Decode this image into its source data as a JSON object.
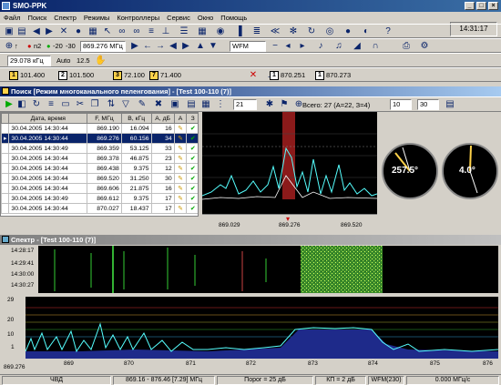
{
  "title": "SMO-PPK",
  "menu": [
    "Файл",
    "Поиск",
    "Спектр",
    "Режимы",
    "Контроллеры",
    "Сервис",
    "Окно",
    "Помощь"
  ],
  "clock": "14:31:17",
  "toolbar2": {
    "n2": "n2",
    "n20": "-20",
    "n30": "-30",
    "freq": "869.276 МГц",
    "mode": "WFM"
  },
  "toolbar3": {
    "step": "29.078 кГц",
    "auto": "Auto",
    "auto_val": "12.5"
  },
  "toolbar4": {
    "b1": "101.400",
    "b2": "101.500",
    "b3": "72.100",
    "b4": "71.400",
    "c1": "870.251",
    "c2": "870.273"
  },
  "search_window": {
    "title": "Поиск [Режим многоканального пеленгования] - [Test 100-110 (7)]",
    "spin1": "21",
    "total": "Всего: 27 (А=22, З=4)",
    "spin2": "10",
    "spin3": "30"
  },
  "table": {
    "headers": [
      "Дата, время",
      "F, МГц",
      "В, кГц",
      "А, дБ",
      "А",
      "З"
    ],
    "rows": [
      [
        "30.04.2005 14:30:44",
        "869.190",
        "16.094",
        "16"
      ],
      [
        "30.04.2005 14:30:44",
        "869.276",
        "60.156",
        "34"
      ],
      [
        "30.04.2005 14:30:49",
        "869.359",
        "53.125",
        "33"
      ],
      [
        "30.04.2005 14:30:44",
        "869.378",
        "46.875",
        "23"
      ],
      [
        "30.04.2005 14:30:44",
        "869.438",
        "9.375",
        "12"
      ],
      [
        "30.04.2005 14:30:44",
        "869.520",
        "31.250",
        "30"
      ],
      [
        "30.04.2005 14:30:44",
        "869.606",
        "21.875",
        "16"
      ],
      [
        "30.04.2005 14:30:49",
        "869.612",
        "9.375",
        "17"
      ],
      [
        "30.04.2005 14:30:44",
        "870.027",
        "18.437",
        "17"
      ]
    ]
  },
  "spectrum_small": {
    "ticks": [
      "869.029",
      "869.276",
      "869.520"
    ]
  },
  "compass": {
    "left": "257.5°",
    "right": "4.0°"
  },
  "spectrum_window": {
    "title": "Спектр - [Test 100-110 (7)]"
  },
  "waterfall": {
    "times": [
      "14:28:17",
      "14:29:41",
      "14:30:00",
      "14:30:27"
    ]
  },
  "spectrum": {
    "ylabel_top": "29",
    "yticks": [
      "20",
      "10",
      "1"
    ],
    "left_freq": "869.276",
    "xticks": [
      "869",
      "870",
      "871",
      "872",
      "873",
      "874",
      "875",
      "876"
    ]
  },
  "status": {
    "s1": "ЧВД",
    "s2": "869.16 - 876.46  [7.29] МГц",
    "s3": "Порог = 25 дБ",
    "s4": "КП = 2 дБ",
    "s5": "WFM(230)",
    "s6": "0.000 МГц/с"
  }
}
